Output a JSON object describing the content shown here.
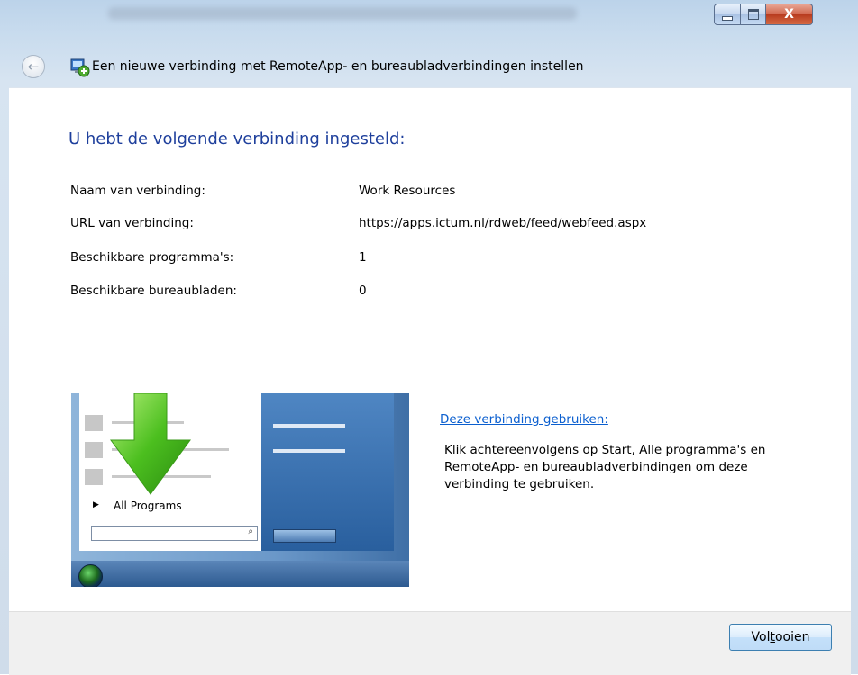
{
  "window": {
    "title": "Een nieuwe verbinding met RemoteApp- en bureaubladverbindingen instellen",
    "caption_buttons": {
      "minimize": "minimize",
      "maximize": "maximize",
      "close": "X"
    }
  },
  "main": {
    "heading": "U hebt de volgende verbinding ingesteld:",
    "rows": [
      {
        "label": "Naam van verbinding:",
        "value": "Work Resources"
      },
      {
        "label": "URL van verbinding:",
        "value": "https://apps.ictum.nl/rdweb/feed/webfeed.aspx"
      },
      {
        "label": "Beschikbare programma's:",
        "value": "1"
      },
      {
        "label": "Beschikbare bureaubladen:",
        "value": "0"
      }
    ],
    "illustration": {
      "all_programs_label": "All Programs"
    },
    "link_label": "Deze verbinding gebruiken:",
    "description": "Klik achtereenvolgens op Start, Alle programma's en RemoteApp- en bureaubladverbindingen om deze verbinding te gebruiken."
  },
  "footer": {
    "finish_pre": "Vol",
    "finish_accel": "t",
    "finish_post": "ooien"
  },
  "colors": {
    "heading": "#1e3f9c",
    "link": "#0b5fcf",
    "arrow": "#4cbf1f"
  }
}
